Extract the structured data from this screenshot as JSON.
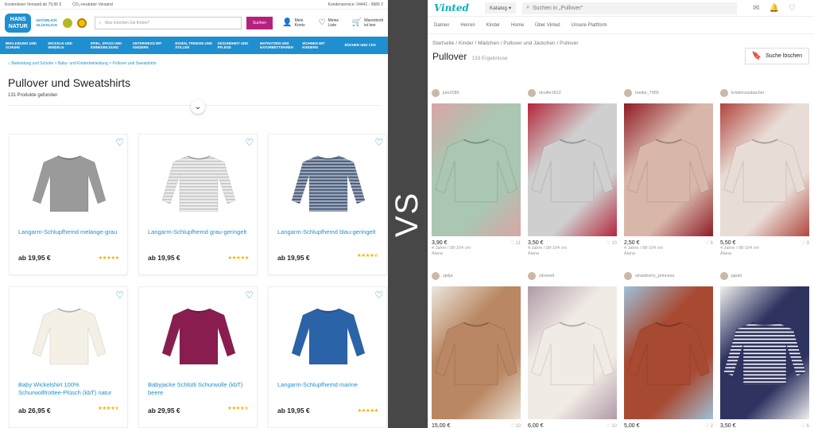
{
  "left": {
    "topbar": {
      "shipping": "Kostenloser Versand ab 79,95 €",
      "eco": "CO₂-neutraler Versand",
      "service": "Kundenservice: 04441 - 9989 2"
    },
    "logo": {
      "line1": "HANS",
      "line2": "NATUR",
      "tagline": "NATÜRLICH GLÜCKLICH"
    },
    "search": {
      "placeholder": "Was möchten Sie finden?",
      "button": "Suchen"
    },
    "header_icons": [
      {
        "icon": "user-icon",
        "label": "Mein Konto"
      },
      {
        "icon": "heart-icon",
        "label": "Meine Liste"
      },
      {
        "icon": "cart-icon",
        "label": "Warenkorb ist leer"
      }
    ],
    "nav": [
      "Bekleidung und Schuhe",
      "Wickeln und Windeln",
      "Spiel, Spaß und Sinnesbildung",
      "Unterwegs mit Kindern",
      "Essen, Trinken und Stillen",
      "Gesundheit und Pflege",
      "Matratzen und Naturbettwaren",
      "Wohnen mit Kindern",
      "Bücher und CDs"
    ],
    "breadcrumb": "Bekleidung und Schuhe  >  Baby- und Kinderbekleidung  >  Pullover und Sweatshirts",
    "title": "Pullover und Sweatshirts",
    "count": "131 Produkte gefunden",
    "products": [
      {
        "name": "Langarm-Schlupfhemd melange-grau",
        "price": "ab 19,95 €",
        "color": "#9a9a9a",
        "stripe": "",
        "rating": 5
      },
      {
        "name": "Langarm-Schlupfhemd grau-geringelt",
        "price": "ab 19,95 €",
        "color": "#ececec",
        "stripe": "#c4c4c4",
        "rating": 5
      },
      {
        "name": "Langarm-Schlupfhemd blau-geringelt",
        "price": "ab 19,95 €",
        "color": "#9aa5b5",
        "stripe": "#3b4f73",
        "rating": 4.5
      },
      {
        "name": "Baby Wickelshirt 100% Schurwollfrottee-Plüsch (kbT) natur",
        "price": "ab 26,95 €",
        "color": "#f5f0e6",
        "stripe": "",
        "rating": 4.5
      },
      {
        "name": "Babyjacke Schlütli Schurwolle (kbT) beere",
        "price": "ab 29,95 €",
        "color": "#8a1d4f",
        "stripe": "",
        "rating": 4.5
      },
      {
        "name": "Langarm-Schlupfhemd marine",
        "price": "ab 19,95 €",
        "color": "#2b63a8",
        "stripe": "",
        "rating": 5
      }
    ]
  },
  "vs": {
    "text": "VS"
  },
  "right": {
    "logo": "Vinted",
    "catalog": "Katalog",
    "search_placeholder": "Suchen in „Pullover\"",
    "nav": [
      "Damen",
      "Herren",
      "Kinder",
      "Home",
      "Über Vinted",
      "Unsere Plattform"
    ],
    "breadcrumb": "Startseite  /  Kinder  /  Mädchen  /  Pullover und Jäckchen  /  Pullover",
    "title": "Pullover",
    "count": "133 Ergebnisse",
    "save_search": "Suche löschen",
    "items": [
      {
        "user": "jule2086",
        "price": "3,90 €",
        "likes": "11",
        "size": "4 Jahre / 98-104 cm",
        "brand": "Alana",
        "color": "#a9c7b2",
        "accent": "#d9a5a5"
      },
      {
        "user": "nicolle1812",
        "price": "3,50 €",
        "likes": "10",
        "size": "4 Jahre / 98-104 cm",
        "brand": "Alana",
        "color": "#cfcfcf",
        "accent": "#b3263a"
      },
      {
        "user": "meike_7955",
        "price": "2,50 €",
        "likes": "6",
        "size": "4 Jahre / 98-104 cm",
        "brand": "Alana",
        "color": "#d8b7aa",
        "accent": "#8e1b25"
      },
      {
        "user": "kristinrossbacher",
        "price": "5,50 €",
        "likes": "9",
        "size": "4 Jahre / 98-104 cm",
        "brand": "Alana",
        "color": "#e8ddd6",
        "accent": "#b0463e"
      },
      {
        "user": "zjelja",
        "price": "15,00 €",
        "likes": "10",
        "size": "",
        "brand": "",
        "color": "#b98763",
        "accent": "#ece6dc"
      },
      {
        "user": "zitronell",
        "price": "6,00 €",
        "likes": "10",
        "size": "",
        "brand": "",
        "color": "#f1ebe5",
        "accent": "#b09aa8"
      },
      {
        "user": "strawberry_princess",
        "price": "5,00 €",
        "likes": "2",
        "size": "",
        "brand": "",
        "color": "#a84a32",
        "accent": "#9fc1d8"
      },
      {
        "user": "japali",
        "price": "3,50 €",
        "likes": "6",
        "size": "",
        "brand": "",
        "color": "#2e3360",
        "accent": "#efefef"
      }
    ]
  }
}
